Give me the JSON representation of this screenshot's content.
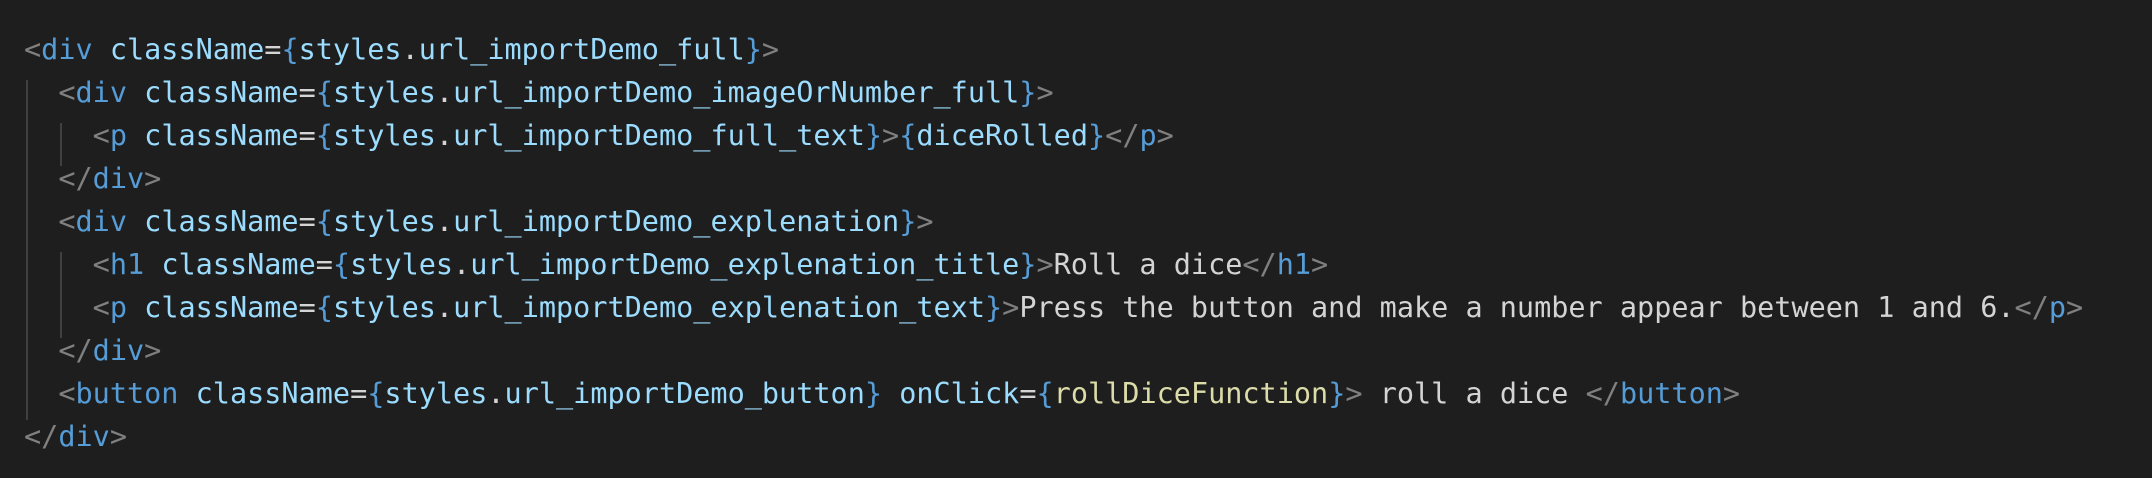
{
  "editor": {
    "lines": [
      {
        "indent": "",
        "tokens": [
          {
            "t": "<",
            "k": "punc"
          },
          {
            "t": "div",
            "k": "tag"
          },
          {
            "t": " ",
            "k": "txt"
          },
          {
            "t": "className",
            "k": "attr"
          },
          {
            "t": "=",
            "k": "txt"
          },
          {
            "t": "{",
            "k": "brace"
          },
          {
            "t": "styles",
            "k": "ident"
          },
          {
            "t": ".",
            "k": "txt"
          },
          {
            "t": "url_importDemo_full",
            "k": "ident"
          },
          {
            "t": "}",
            "k": "brace"
          },
          {
            "t": ">",
            "k": "punc"
          }
        ]
      },
      {
        "indent": "  ",
        "tokens": [
          {
            "t": "<",
            "k": "punc"
          },
          {
            "t": "div",
            "k": "tag"
          },
          {
            "t": " ",
            "k": "txt"
          },
          {
            "t": "className",
            "k": "attr"
          },
          {
            "t": "=",
            "k": "txt"
          },
          {
            "t": "{",
            "k": "brace"
          },
          {
            "t": "styles",
            "k": "ident"
          },
          {
            "t": ".",
            "k": "txt"
          },
          {
            "t": "url_importDemo_imageOrNumber_full",
            "k": "ident"
          },
          {
            "t": "}",
            "k": "brace"
          },
          {
            "t": ">",
            "k": "punc"
          }
        ]
      },
      {
        "indent": "    ",
        "tokens": [
          {
            "t": "<",
            "k": "punc"
          },
          {
            "t": "p",
            "k": "tag"
          },
          {
            "t": " ",
            "k": "txt"
          },
          {
            "t": "className",
            "k": "attr"
          },
          {
            "t": "=",
            "k": "txt"
          },
          {
            "t": "{",
            "k": "brace"
          },
          {
            "t": "styles",
            "k": "ident"
          },
          {
            "t": ".",
            "k": "txt"
          },
          {
            "t": "url_importDemo_full_text",
            "k": "ident"
          },
          {
            "t": "}",
            "k": "brace"
          },
          {
            "t": ">",
            "k": "punc"
          },
          {
            "t": "{",
            "k": "brace"
          },
          {
            "t": "diceRolled",
            "k": "ident"
          },
          {
            "t": "}",
            "k": "brace"
          },
          {
            "t": "</",
            "k": "punc"
          },
          {
            "t": "p",
            "k": "tag"
          },
          {
            "t": ">",
            "k": "punc"
          }
        ]
      },
      {
        "indent": "  ",
        "tokens": [
          {
            "t": "</",
            "k": "punc"
          },
          {
            "t": "div",
            "k": "tag"
          },
          {
            "t": ">",
            "k": "punc"
          }
        ]
      },
      {
        "indent": "  ",
        "tokens": [
          {
            "t": "<",
            "k": "punc"
          },
          {
            "t": "div",
            "k": "tag"
          },
          {
            "t": " ",
            "k": "txt"
          },
          {
            "t": "className",
            "k": "attr"
          },
          {
            "t": "=",
            "k": "txt"
          },
          {
            "t": "{",
            "k": "brace"
          },
          {
            "t": "styles",
            "k": "ident"
          },
          {
            "t": ".",
            "k": "txt"
          },
          {
            "t": "url_importDemo_explenation",
            "k": "ident"
          },
          {
            "t": "}",
            "k": "brace"
          },
          {
            "t": ">",
            "k": "punc"
          }
        ]
      },
      {
        "indent": "    ",
        "tokens": [
          {
            "t": "<",
            "k": "punc"
          },
          {
            "t": "h1",
            "k": "tag"
          },
          {
            "t": " ",
            "k": "txt"
          },
          {
            "t": "className",
            "k": "attr"
          },
          {
            "t": "=",
            "k": "txt"
          },
          {
            "t": "{",
            "k": "brace"
          },
          {
            "t": "styles",
            "k": "ident"
          },
          {
            "t": ".",
            "k": "txt"
          },
          {
            "t": "url_importDemo_explenation_title",
            "k": "ident"
          },
          {
            "t": "}",
            "k": "brace"
          },
          {
            "t": ">",
            "k": "punc"
          },
          {
            "t": "Roll a dice",
            "k": "txt"
          },
          {
            "t": "</",
            "k": "punc"
          },
          {
            "t": "h1",
            "k": "tag"
          },
          {
            "t": ">",
            "k": "punc"
          }
        ]
      },
      {
        "indent": "    ",
        "tokens": [
          {
            "t": "<",
            "k": "punc"
          },
          {
            "t": "p",
            "k": "tag"
          },
          {
            "t": " ",
            "k": "txt"
          },
          {
            "t": "className",
            "k": "attr"
          },
          {
            "t": "=",
            "k": "txt"
          },
          {
            "t": "{",
            "k": "brace"
          },
          {
            "t": "styles",
            "k": "ident"
          },
          {
            "t": ".",
            "k": "txt"
          },
          {
            "t": "url_importDemo_explenation_text",
            "k": "ident"
          },
          {
            "t": "}",
            "k": "brace"
          },
          {
            "t": ">",
            "k": "punc"
          },
          {
            "t": "Press the button and make a number appear between 1 and 6.",
            "k": "txt"
          },
          {
            "t": "</",
            "k": "punc"
          },
          {
            "t": "p",
            "k": "tag"
          },
          {
            "t": ">",
            "k": "punc"
          }
        ]
      },
      {
        "indent": "  ",
        "tokens": [
          {
            "t": "</",
            "k": "punc"
          },
          {
            "t": "div",
            "k": "tag"
          },
          {
            "t": ">",
            "k": "punc"
          }
        ]
      },
      {
        "indent": "  ",
        "tokens": [
          {
            "t": "<",
            "k": "punc"
          },
          {
            "t": "button",
            "k": "tag"
          },
          {
            "t": " ",
            "k": "txt"
          },
          {
            "t": "className",
            "k": "attr"
          },
          {
            "t": "=",
            "k": "txt"
          },
          {
            "t": "{",
            "k": "brace"
          },
          {
            "t": "styles",
            "k": "ident"
          },
          {
            "t": ".",
            "k": "txt"
          },
          {
            "t": "url_importDemo_button",
            "k": "ident"
          },
          {
            "t": "}",
            "k": "brace"
          },
          {
            "t": " ",
            "k": "txt"
          },
          {
            "t": "onClick",
            "k": "attr"
          },
          {
            "t": "=",
            "k": "txt"
          },
          {
            "t": "{",
            "k": "brace"
          },
          {
            "t": "rollDiceFunction",
            "k": "fn"
          },
          {
            "t": "}",
            "k": "brace"
          },
          {
            "t": ">",
            "k": "punc"
          },
          {
            "t": " roll a dice ",
            "k": "txt"
          },
          {
            "t": "</",
            "k": "punc"
          },
          {
            "t": "button",
            "k": "tag"
          },
          {
            "t": ">",
            "k": "punc"
          }
        ]
      },
      {
        "indent": "",
        "tokens": [
          {
            "t": "</",
            "k": "punc"
          },
          {
            "t": "div",
            "k": "tag"
          },
          {
            "t": ">",
            "k": "punc"
          }
        ]
      }
    ]
  }
}
